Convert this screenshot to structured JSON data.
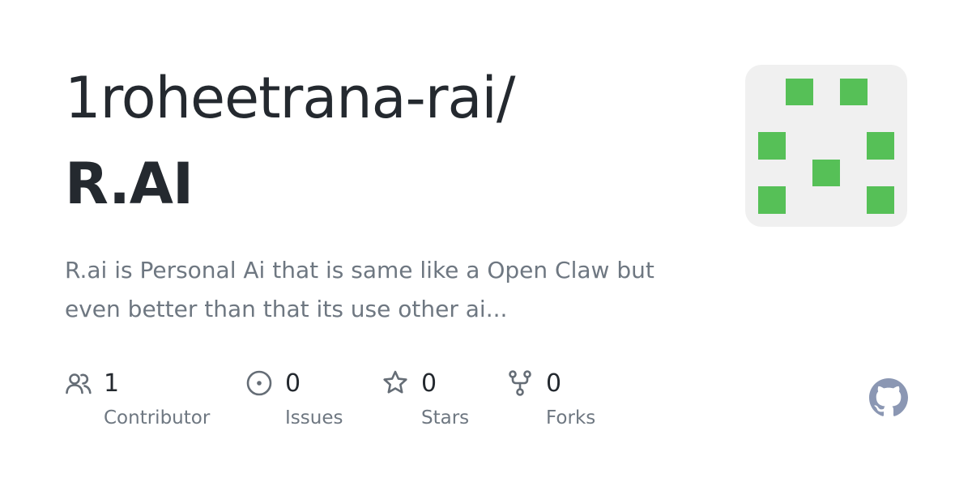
{
  "repo": {
    "owner": "1roheetrana-rai/",
    "name": "R.AI",
    "description_line1": "R.ai is Personal Ai that is same like a Open Claw but",
    "description_line2": "even better than that its use other ai..."
  },
  "avatar": {
    "icon": "identicon",
    "color": "#56c057",
    "background": "#f0f0f0"
  },
  "stats": [
    {
      "icon": "people-icon",
      "count": "1",
      "label": "Contributor"
    },
    {
      "icon": "issue-icon",
      "count": "0",
      "label": "Issues"
    },
    {
      "icon": "star-icon",
      "count": "0",
      "label": "Stars"
    },
    {
      "icon": "fork-icon",
      "count": "0",
      "label": "Forks"
    }
  ],
  "brand": {
    "logo": "github-icon",
    "logo_color": "#8b97b3"
  }
}
